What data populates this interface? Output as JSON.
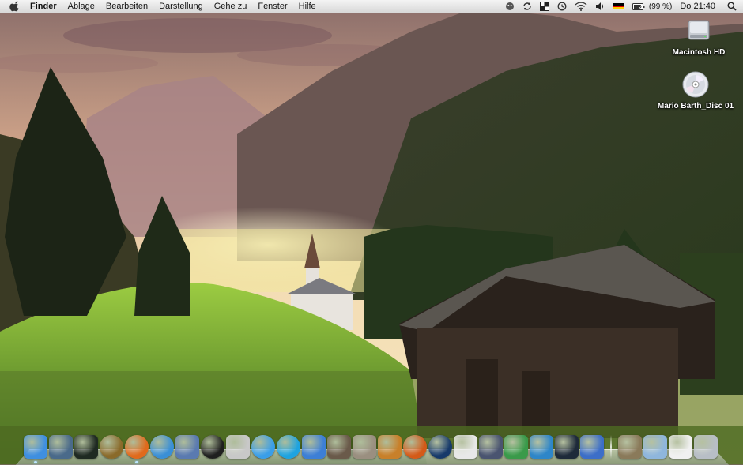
{
  "menubar": {
    "app_name": "Finder",
    "items": [
      "Ablage",
      "Bearbeiten",
      "Darstellung",
      "Gehe zu",
      "Fenster",
      "Hilfe"
    ],
    "status": {
      "battery_percent": "(99 %)",
      "clock": "Do 21:40",
      "icons": [
        "growl-icon",
        "sync-icon",
        "spaces-icon",
        "time-machine-icon",
        "wifi-icon",
        "volume-icon",
        "german-flag-icon",
        "battery-icon",
        "spotlight-icon"
      ]
    }
  },
  "desktop": {
    "icons": [
      {
        "label": "Macintosh HD",
        "icon": "hard-drive-icon"
      },
      {
        "label": "Mario Barth_Disc 01",
        "icon": "disc-icon"
      }
    ]
  },
  "dock": {
    "apps": [
      {
        "icon": "finder-icon",
        "color": "#3f8fe0",
        "running": true
      },
      {
        "icon": "dashboard-icon",
        "color": "#4a6a8a",
        "running": false
      },
      {
        "icon": "activity-monitor-icon",
        "color": "#1f2a22",
        "running": false
      },
      {
        "icon": "gauge-icon",
        "color": "#8a6a2a",
        "running": false
      },
      {
        "icon": "firefox-icon",
        "color": "#e06a1c",
        "running": true
      },
      {
        "icon": "safari-icon",
        "color": "#3a8fd6",
        "running": false
      },
      {
        "icon": "preview-icon",
        "color": "#5a7ab0",
        "running": false
      },
      {
        "icon": "burn-icon",
        "color": "#1f1f1f",
        "running": false
      },
      {
        "icon": "adium-icon",
        "color": "#c8c8c8",
        "running": false
      },
      {
        "icon": "ichat-icon",
        "color": "#3a9ee8",
        "running": false
      },
      {
        "icon": "skype-icon",
        "color": "#1ea3e0",
        "running": false
      },
      {
        "icon": "itunes-icon",
        "color": "#3d7fd6",
        "running": false
      },
      {
        "icon": "iphoto-icon",
        "color": "#6a5a4a",
        "running": false
      },
      {
        "icon": "image-capture-icon",
        "color": "#9a8f80",
        "running": false
      },
      {
        "icon": "garageband-icon",
        "color": "#c8802a",
        "running": false
      },
      {
        "icon": "reason-icon",
        "color": "#d45a18",
        "running": false
      },
      {
        "icon": "sp-icon",
        "color": "#173a6a",
        "running": false
      },
      {
        "icon": "document-icon",
        "color": "#e8e8e8",
        "running": false
      },
      {
        "icon": "quill-icon",
        "color": "#4a5470",
        "running": false
      },
      {
        "icon": "numbers-icon",
        "color": "#3a9a4a",
        "running": false
      },
      {
        "icon": "wunderlist-icon",
        "color": "#2e86c8",
        "running": false
      },
      {
        "icon": "eyetv-icon",
        "color": "#1e2a3a",
        "running": false
      },
      {
        "icon": "xcode-icon",
        "color": "#3c6ec8",
        "running": false
      }
    ],
    "right": [
      {
        "icon": "downloads-stack-icon",
        "color": "#8a7a5a"
      },
      {
        "icon": "applications-folder-icon",
        "color": "#8fb6dc"
      },
      {
        "icon": "documents-stack-icon",
        "color": "#f0f0f0"
      },
      {
        "icon": "trash-icon",
        "color": "#b8bec6"
      }
    ]
  }
}
